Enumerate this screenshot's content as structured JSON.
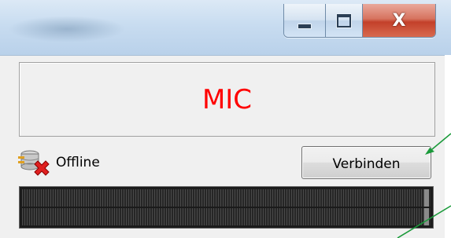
{
  "window": {
    "minimize_icon": "minimize-icon",
    "maximize_icon": "maximize-icon",
    "close_glyph": "X"
  },
  "display": {
    "label": "MIC",
    "label_color": "#ff0000"
  },
  "status": {
    "icon": "disconnected-server-icon",
    "text": "Offline"
  },
  "connect_button": {
    "label": "Verbinden"
  },
  "level_meter": {
    "channels": 2
  },
  "colors": {
    "annotation_arrow": "#1a9a3a",
    "close_button": "#c3402a"
  }
}
